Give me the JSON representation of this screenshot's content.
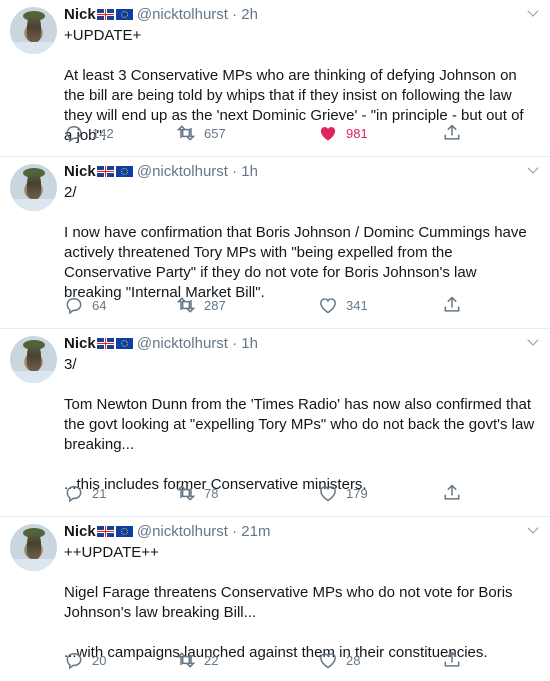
{
  "colors": {
    "link": "#1da1f2",
    "muted": "#657786",
    "like": "#e0245e",
    "text": "#14171a"
  },
  "tweets": [
    {
      "name": "Nick",
      "handle": "@nicktolhurst",
      "dot": "·",
      "time": "2h",
      "lines": [
        "+UPDATE+",
        "",
        "At least 3 Conservative MPs who are thinking of defying Johnson on the bill are being told by whips that if they insist on following the law they will end up as the 'next Dominic Grieve' - \"in principle - but out of a job\"."
      ],
      "replies": "142",
      "retweets": "657",
      "likes": "981",
      "liked": true
    },
    {
      "name": "Nick",
      "handle": "@nicktolhurst",
      "dot": "·",
      "time": "1h",
      "lines": [
        "2/",
        "",
        "I now have confirmation that Boris Johnson / Dominc Cummings have actively threatened Tory MPs with \"being expelled from the Conservative Party\" if they do not vote for Boris Johnson's law breaking \"Internal Market Bill\"."
      ],
      "replies": "64",
      "retweets": "287",
      "likes": "341",
      "liked": false
    },
    {
      "name": "Nick",
      "handle": "@nicktolhurst",
      "dot": "·",
      "time": "1h",
      "lines": [
        "3/",
        "",
        "Tom Newton Dunn from the 'Times Radio' has now also confirmed that the govt looking at \"expelling Tory MPs\" who do not back the govt's law breaking...",
        "",
        "...this includes former Conservative ministers."
      ],
      "replies": "21",
      "retweets": "78",
      "likes": "179",
      "liked": false
    },
    {
      "name": "Nick",
      "handle": "@nicktolhurst",
      "dot": "·",
      "time": "21m",
      "lines": [
        "++UPDATE++",
        "",
        "Nigel Farage threatens Conservative MPs who do not vote for Boris Johnson's law breaking Bill...",
        "",
        "...with campaigns launched against them in their constituencies."
      ],
      "replies": "20",
      "retweets": "22",
      "likes": "28",
      "liked": false
    }
  ]
}
